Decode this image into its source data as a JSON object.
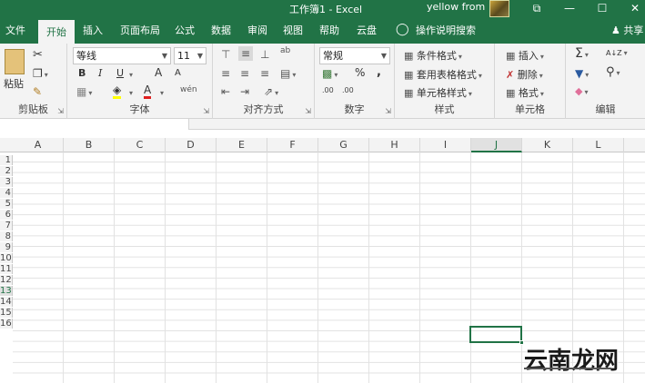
{
  "window": {
    "title": "工作簿1  -  Excel",
    "user_name": "yellow from",
    "buttons": [
      "⧉",
      "—",
      "☐",
      "✕"
    ]
  },
  "tabs": [
    {
      "label": "文件",
      "active": false
    },
    {
      "label": "开始",
      "active": true
    },
    {
      "label": "插入",
      "active": false
    },
    {
      "label": "页面布局",
      "active": false
    },
    {
      "label": "公式",
      "active": false
    },
    {
      "label": "数据",
      "active": false
    },
    {
      "label": "审阅",
      "active": false
    },
    {
      "label": "视图",
      "active": false
    },
    {
      "label": "帮助",
      "active": false
    },
    {
      "label": "云盘",
      "active": false
    }
  ],
  "search": {
    "label": "操作说明搜索"
  },
  "share": {
    "label": "共享"
  },
  "ribbon": {
    "clipboard": {
      "label": "剪贴板",
      "paste": "粘贴"
    },
    "font": {
      "label": "字体",
      "font_name": "等线",
      "font_size": "11",
      "bold": "B",
      "italic": "I",
      "underline": "U",
      "grow": "A",
      "shrink": "A",
      "font_color": "A",
      "phonetic": "wén"
    },
    "alignment": {
      "label": "对齐方式",
      "wrap": "ab"
    },
    "number": {
      "label": "数字",
      "format": "常规",
      "percent": "%",
      "comma": ",",
      "inc_decimal": ".00",
      "dec_decimal": ".00"
    },
    "styles": {
      "label": "样式",
      "conditional": "条件格式",
      "table": "套用表格格式",
      "cell": "单元格样式"
    },
    "cells": {
      "label": "单元格",
      "insert": "插入",
      "delete": "删除",
      "format": "格式"
    },
    "editing": {
      "label": "编辑",
      "sum": "Σ",
      "sort": "A↓Z",
      "find": "⚲",
      "clear": "◆"
    }
  },
  "grid": {
    "columns": [
      "A",
      "B",
      "C",
      "D",
      "E",
      "F",
      "G",
      "H",
      "I",
      "J",
      "K",
      "L"
    ],
    "selected_column": "J",
    "rows": [
      "1",
      "2",
      "3",
      "4",
      "5",
      "6",
      "7",
      "8",
      "9",
      "10",
      "11",
      "12",
      "13",
      "14",
      "15",
      "16"
    ],
    "selected_row": "13"
  },
  "watermark": {
    "text": "云南龙网"
  }
}
